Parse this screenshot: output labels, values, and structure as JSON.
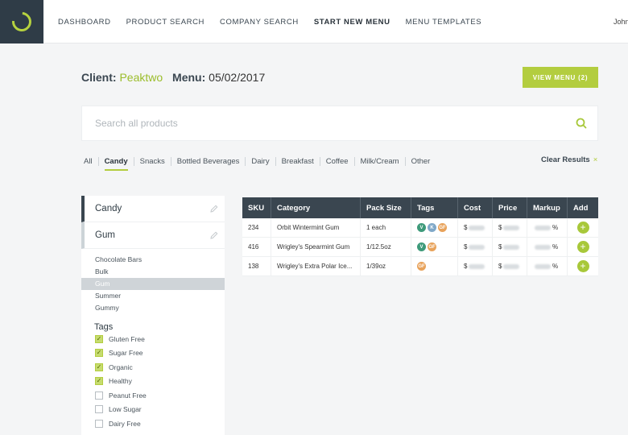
{
  "nav": {
    "items": [
      "DASHBOARD",
      "PRODUCT SEARCH",
      "COMPANY SEARCH",
      "START NEW MENU",
      "MENU TEMPLATES"
    ],
    "active_index": 3,
    "user": "John"
  },
  "header": {
    "client_label": "Client:",
    "client_name": "Peaktwo",
    "menu_label": "Menu:",
    "menu_date": "05/02/2017",
    "view_menu_button": "VIEW MENU (2)"
  },
  "search": {
    "placeholder": "Search all products",
    "value": ""
  },
  "categories": {
    "items": [
      "All",
      "Candy",
      "Snacks",
      "Bottled Beverages",
      "Dairy",
      "Breakfast",
      "Coffee",
      "Milk/Cream",
      "Other"
    ],
    "active_index": 1,
    "clear_label": "Clear Results",
    "clear_icon": "×"
  },
  "sidebar": {
    "groups": [
      "Candy",
      "Gum"
    ],
    "subcategories": [
      "Chocolate Bars",
      "Bulk",
      "Gum",
      "Summer",
      "Gummy"
    ],
    "selected_sub_index": 2,
    "tags_title": "Tags",
    "tags": [
      {
        "label": "Gluten Free",
        "checked": true
      },
      {
        "label": "Sugar Free",
        "checked": true
      },
      {
        "label": "Organic",
        "checked": true
      },
      {
        "label": "Healthy",
        "checked": true
      },
      {
        "label": "Peanut Free",
        "checked": false
      },
      {
        "label": "Low Sugar",
        "checked": false
      },
      {
        "label": "Dairy Free",
        "checked": false
      }
    ]
  },
  "table": {
    "columns": [
      "SKU",
      "Category",
      "Pack Size",
      "Tags",
      "Cost",
      "Price",
      "Markup",
      "Add"
    ],
    "rows": [
      {
        "sku": "234",
        "category": "Orbit Wintermint Gum",
        "pack": "1 each",
        "tags": [
          "V",
          "K",
          "GF"
        ],
        "cost_symbol": "$",
        "price_symbol": "$",
        "markup_symbol": "%"
      },
      {
        "sku": "416",
        "category": "Wrigley's Spearmint Gum",
        "pack": "1/12.5oz",
        "tags": [
          "V",
          "GF"
        ],
        "cost_symbol": "$",
        "price_symbol": "$",
        "markup_symbol": "%"
      },
      {
        "sku": "138",
        "category": "Wrigley's Extra Polar Ice...",
        "pack": "1/39oz",
        "tags": [
          "GF"
        ],
        "cost_symbol": "$",
        "price_symbol": "$",
        "markup_symbol": "%"
      }
    ],
    "add_symbol": "+",
    "tag_colors": {
      "V": "#3e9a7a",
      "K": "#7fa8c8",
      "GF": "#e8a25a"
    }
  },
  "colors": {
    "accent": "#b3cd3f",
    "dark": "#3a4650",
    "logo_bg": "#2f3c47"
  }
}
